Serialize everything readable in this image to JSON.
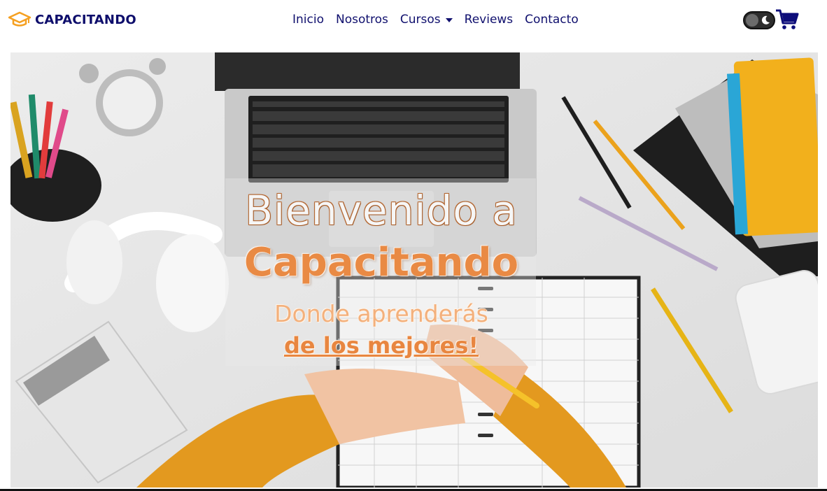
{
  "brand": {
    "name": "CAPACITANDO",
    "icon": "graduation-cap-icon"
  },
  "nav": {
    "items": [
      {
        "label": "Inicio"
      },
      {
        "label": "Nosotros"
      },
      {
        "label": "Cursos",
        "has_dropdown": true
      },
      {
        "label": "Reviews"
      },
      {
        "label": "Contacto"
      }
    ]
  },
  "toggle": {
    "icon": "moon-icon",
    "state": "off"
  },
  "cart": {
    "icon": "shopping-cart-icon"
  },
  "hero": {
    "title": "Bienvenido a",
    "brand": "Capacitando",
    "subtitle": "Donde aprenderás",
    "link": "de los mejores!"
  },
  "colors": {
    "brand_navy": "#0d0d6b",
    "accent_orange": "#e98a44",
    "cap_orange": "#f5a021"
  }
}
